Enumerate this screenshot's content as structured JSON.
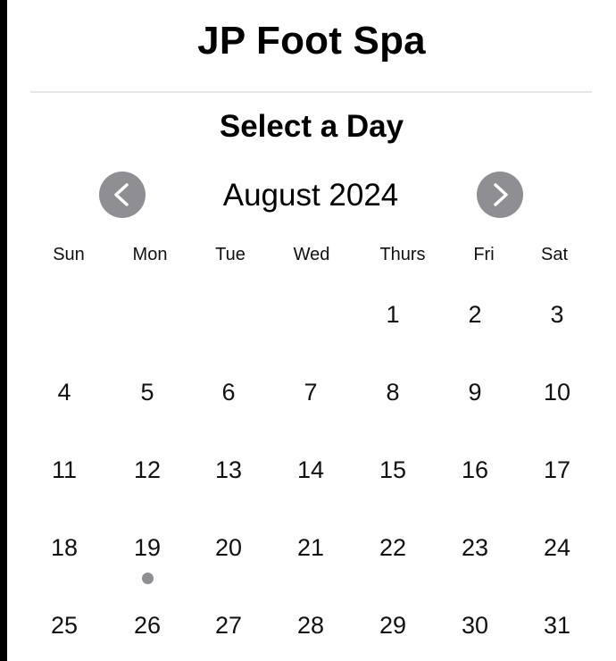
{
  "header": {
    "title": "JP Foot Spa"
  },
  "section": {
    "title": "Select a Day"
  },
  "calendar": {
    "month_label": "August 2024",
    "prev_icon": "chevron-left-icon",
    "next_icon": "chevron-right-icon",
    "weekdays": [
      "Sun",
      "Mon",
      "Tue",
      "Wed",
      "Thurs",
      "Fri",
      "Sat"
    ],
    "first_weekday_index": 4,
    "days": [
      "1",
      "2",
      "3",
      "4",
      "5",
      "6",
      "7",
      "8",
      "9",
      "10",
      "11",
      "12",
      "13",
      "14",
      "15",
      "16",
      "17",
      "18",
      "19",
      "20",
      "21",
      "22",
      "23",
      "24",
      "25",
      "26",
      "27",
      "28",
      "29",
      "30",
      "31"
    ],
    "marked_days": [
      "19"
    ],
    "marker_color": "#8e8e93"
  }
}
